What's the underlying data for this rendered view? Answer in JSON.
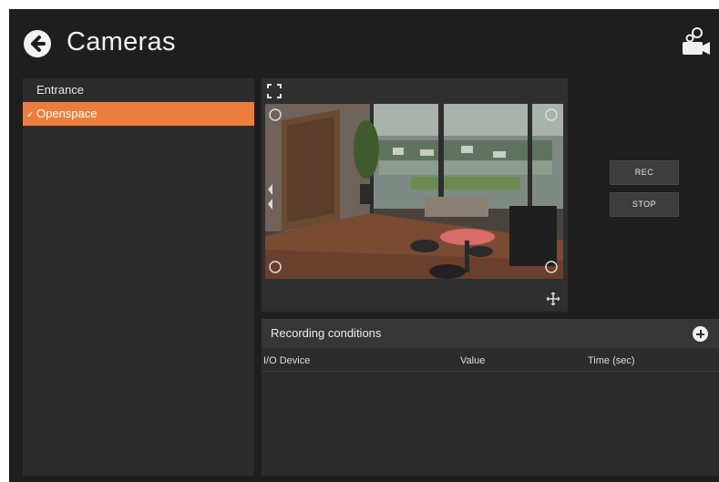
{
  "header": {
    "title": "Cameras",
    "back_icon": "arrow-left-circle-icon",
    "camera_icon": "camera-settings-icon"
  },
  "camera_list": {
    "items": [
      {
        "label": "Entrance",
        "selected": false
      },
      {
        "label": "Openspace",
        "selected": true
      }
    ],
    "selected_color": "#ec7e3d",
    "check_glyph": "✓"
  },
  "video": {
    "fullscreen_icon": "fullscreen-icon",
    "ptz_icon": "move-cross-icon"
  },
  "controls": {
    "rec_label": "REC",
    "stop_label": "STOP"
  },
  "recording_conditions": {
    "title": "Recording conditions",
    "add_icon": "plus-circle-icon",
    "columns": [
      "I/O Device",
      "Value",
      "Time (sec)"
    ],
    "rows": []
  }
}
